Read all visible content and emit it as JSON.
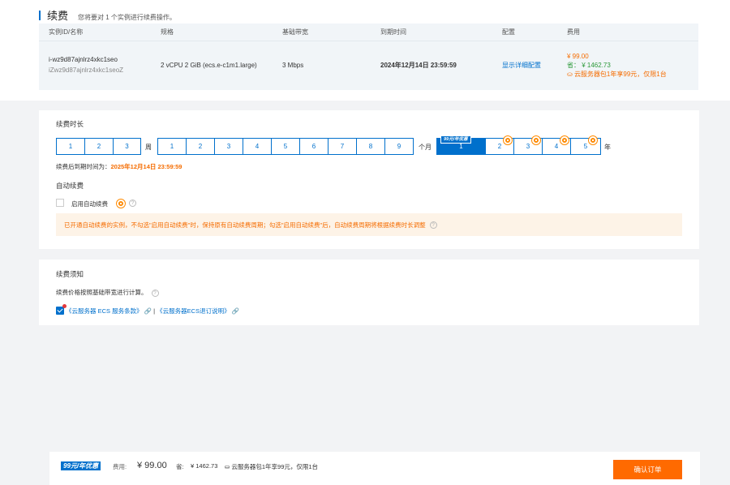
{
  "header": {
    "title": "续费",
    "subtitle": "您将要对 1 个实例进行续费操作。"
  },
  "instance_table": {
    "columns": [
      "实例ID/名称",
      "规格",
      "基础带宽",
      "到期时间",
      "配置",
      "费用"
    ],
    "row": {
      "id": "i-wz9d87ajnlrz4xkc1seo",
      "name": "iZwz9d87ajnlrz4xkc1seoZ",
      "spec": "2 vCPU 2 GiB (ecs.e-c1m1.large)",
      "bandwidth": "3 Mbps",
      "expire": "2024年12月14日 23:59:59",
      "config_link": "显示详细配置",
      "fee": "¥ 99.00",
      "save": "省： ¥ 1462.73",
      "promo": "云服务器包1年享99元，仅限1台"
    }
  },
  "duration": {
    "label": "续费时长",
    "weeks": [
      "1",
      "2",
      "3"
    ],
    "week_unit": "周",
    "months": [
      "1",
      "2",
      "3",
      "4",
      "5",
      "6",
      "7",
      "8",
      "9"
    ],
    "month_unit": "个月",
    "years": [
      "1",
      "2",
      "3",
      "4",
      "5"
    ],
    "year_unit": "年",
    "selected": "1 年",
    "promo_tag": "99元/年优惠",
    "expire_after_label": "续费后到期时间为：",
    "expire_after_value": "2025年12月14日 23:59:59"
  },
  "auto_renew": {
    "label": "自动续费",
    "checkbox_label": "启用自动续费",
    "help_icon": "question-circle-icon",
    "notice": "已开通自动续费的实例，不勾选\"启用自动续费\"时，保持原有自动续费周期；勾选\"启用自动续费\"后，自动续费周期将根据续费时长调整"
  },
  "terms": {
    "label": "续费须知",
    "note": "续费价格按照基础带宽进行计算。",
    "link1": "《云服务器 ECS 服务条款》",
    "sep": "|",
    "link2": "《云服务器ECS退订说明》"
  },
  "footer": {
    "promo_tag": "99元/年优惠",
    "fee_label": "费用:",
    "fee": "¥ 99.00",
    "save_label": "省:",
    "save_value": "¥ 1462.73",
    "promo": "云服务器包1年享99元，仅限1台",
    "confirm": "确认订单"
  },
  "colors": {
    "accent": "#0070cc",
    "price": "#f56c00",
    "save": "#2b9939",
    "confirm_bg": "#ff6a00"
  }
}
